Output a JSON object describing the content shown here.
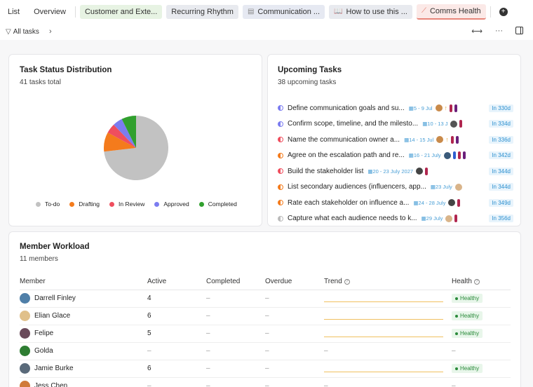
{
  "tabs": [
    {
      "label": "List",
      "style": "plain",
      "icon": ""
    },
    {
      "label": "Overview",
      "style": "plain",
      "icon": ""
    },
    {
      "label": "Customer and Exte...",
      "style": "green",
      "icon": ""
    },
    {
      "label": "Recurring Rhythm",
      "style": "gray",
      "icon": ""
    },
    {
      "label": "Communication ...",
      "style": "lav",
      "icon": "doc-icon"
    },
    {
      "label": "How to use this ...",
      "style": "gray",
      "icon": "book-icon"
    },
    {
      "label": "Comms Health",
      "style": "active",
      "icon": "chart-icon"
    }
  ],
  "filter": {
    "label": "All tasks"
  },
  "status": {
    "title": "Task Status Distribution",
    "subtitle": "41 tasks total",
    "legend": [
      {
        "label": "To-do",
        "color": "#c2c2c2"
      },
      {
        "label": "Drafting",
        "color": "#f47b1c"
      },
      {
        "label": "In Review",
        "color": "#ef4e5e"
      },
      {
        "label": "Approved",
        "color": "#7b7cf0"
      },
      {
        "label": "Completed",
        "color": "#31a02e"
      }
    ]
  },
  "chart_data": {
    "type": "pie",
    "categories": [
      "To-do",
      "Drafting",
      "In Review",
      "Approved",
      "Completed"
    ],
    "values": [
      30,
      4,
      2,
      2,
      3
    ],
    "colors": [
      "#c2c2c2",
      "#f47b1c",
      "#ef4e5e",
      "#7b7cf0",
      "#31a02e"
    ]
  },
  "upcoming": {
    "title": "Upcoming Tasks",
    "subtitle": "38 upcoming tasks",
    "tasks": [
      {
        "name": "Define communication goals and su...",
        "due": "5 - 9 Jul",
        "in": "In 330d",
        "status_color": "#7b7cf0",
        "avatars": [
          "#c98a4a"
        ],
        "arrow": true,
        "pills": [
          "#b0264f",
          "#6a1f7a"
        ]
      },
      {
        "name": "Confirm scope, timeline, and the milesto...",
        "due": "10 - 13 J",
        "in": "In 334d",
        "status_color": "#7b7cf0",
        "avatars": [
          "#555555"
        ],
        "arrow": false,
        "pills": [
          "#b0264f"
        ]
      },
      {
        "name": "Name the communication owner a...",
        "due": "14 - 15 Jul",
        "in": "In 336d",
        "status_color": "#ef4e5e",
        "avatars": [
          "#c98a4a"
        ],
        "arrow": true,
        "pills": [
          "#b0264f",
          "#6a1f7a"
        ]
      },
      {
        "name": "Agree on the escalation path and re...",
        "due": "16 - 21 July",
        "in": "In 342d",
        "status_color": "#f47b1c",
        "avatars": [
          "#3a5a7a"
        ],
        "arrow": false,
        "pills": [
          "#2f5fd0",
          "#b0264f",
          "#6a1f7a"
        ]
      },
      {
        "name": "Build the stakeholder list",
        "due": "20 - 23 July 2027",
        "in": "In 344d",
        "status_color": "#ef4e5e",
        "avatars": [
          "#444444"
        ],
        "arrow": false,
        "pills": [
          "#b0264f"
        ]
      },
      {
        "name": "List secondary audiences (influencers, app...",
        "due": "23 July",
        "in": "In 344d",
        "status_color": "#f47b1c",
        "avatars": [
          "#d9b48a"
        ],
        "arrow": false,
        "pills": []
      },
      {
        "name": "Rate each stakeholder on influence a...",
        "due": "24 - 28 July",
        "in": "In 349d",
        "status_color": "#f47b1c",
        "avatars": [
          "#444444"
        ],
        "arrow": false,
        "pills": [
          "#b0264f"
        ]
      },
      {
        "name": "Capture what each audience needs to k...",
        "due": "29 July",
        "in": "In 356d",
        "status_color": "#bbbbbb",
        "avatars": [
          "#d9b48a"
        ],
        "arrow": false,
        "pills": [
          "#b0264f"
        ]
      }
    ]
  },
  "workload": {
    "title": "Member Workload",
    "subtitle": "11 members",
    "headers": {
      "member": "Member",
      "active": "Active",
      "completed": "Completed",
      "overdue": "Overdue",
      "trend": "Trend",
      "health": "Health"
    },
    "rows": [
      {
        "name": "Darrell Finley",
        "avatar": "#4f7fa8",
        "active": "4",
        "completed": "–",
        "overdue": "–",
        "trend": true,
        "trend_text": "",
        "health": "Healthy"
      },
      {
        "name": "Elian Glace",
        "avatar": "#e0c08a",
        "active": "6",
        "completed": "–",
        "overdue": "–",
        "trend": true,
        "trend_text": "",
        "health": "Healthy"
      },
      {
        "name": "Felipe",
        "avatar": "#6a4a5a",
        "active": "5",
        "completed": "–",
        "overdue": "–",
        "trend": true,
        "trend_text": "",
        "health": "Healthy"
      },
      {
        "name": "Golda",
        "avatar": "#2e7d32",
        "active": "–",
        "completed": "–",
        "overdue": "–",
        "trend": false,
        "trend_text": "–",
        "health": "–"
      },
      {
        "name": "Jamie Burke",
        "avatar": "#5a6a7a",
        "active": "6",
        "completed": "–",
        "overdue": "–",
        "trend": true,
        "trend_text": "",
        "health": "Healthy"
      },
      {
        "name": "Jess Chen",
        "avatar": "#d07a3a",
        "active": "–",
        "completed": "–",
        "overdue": "–",
        "trend": false,
        "trend_text": "–",
        "health": "–"
      }
    ]
  }
}
